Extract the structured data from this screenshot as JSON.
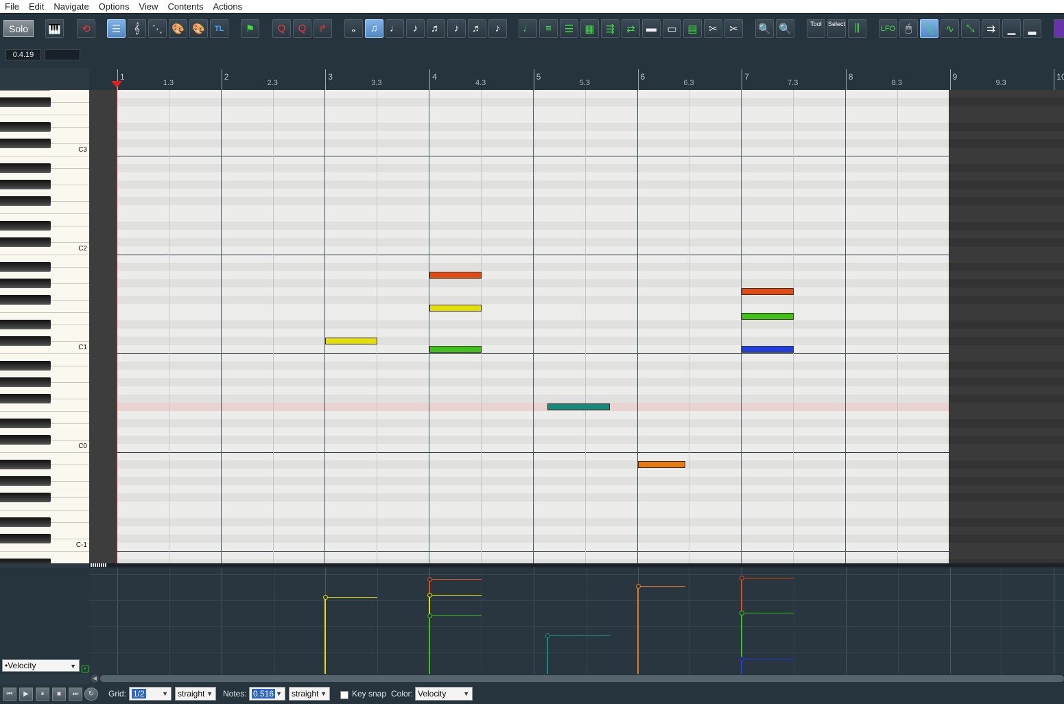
{
  "menu": [
    "File",
    "Edit",
    "Navigate",
    "Options",
    "View",
    "Contents",
    "Actions"
  ],
  "toolbar": {
    "solo_label": "Solo",
    "tl_label": "TL",
    "tool_label": "Tool",
    "select_label": "Select",
    "lfo_label": "LFO"
  },
  "position": {
    "value": "0.4.19",
    "secondary": ""
  },
  "ruler": {
    "bars": [
      "1",
      "2",
      "3",
      "4",
      "5",
      "6",
      "7",
      "8",
      "9",
      "10"
    ],
    "subs": [
      "1.3",
      "2.3",
      "3.3",
      "4.3",
      "5.3",
      "6.3",
      "7.3",
      "8.3",
      "9.3"
    ]
  },
  "keyboard": {
    "labels": [
      "C3",
      "C2",
      "C1",
      "C0",
      "C-1"
    ]
  },
  "notes": [
    {
      "bar": 3,
      "start": 3.0,
      "length": 0.5,
      "pitch": "C1+1",
      "color": "#e5df00",
      "velocity": 0.76
    },
    {
      "bar": 4,
      "start": 4.0,
      "length": 0.5,
      "pitch": "C1+9",
      "color": "#e14a14",
      "velocity": 0.94
    },
    {
      "bar": 4,
      "start": 4.0,
      "length": 0.5,
      "pitch": "C1+5",
      "color": "#e5df00",
      "velocity": 0.78
    },
    {
      "bar": 4,
      "start": 4.0,
      "length": 0.5,
      "pitch": "C1",
      "color": "#3fc11c",
      "velocity": 0.57
    },
    {
      "bar": 5,
      "start": 5.13,
      "length": 0.6,
      "pitch": "C0+5",
      "color": "#138a7c",
      "velocity": 0.37
    },
    {
      "bar": 6,
      "start": 6.0,
      "length": 0.46,
      "pitch": "C0-2",
      "color": "#e67a12",
      "velocity": 0.87
    },
    {
      "bar": 7,
      "start": 7.0,
      "length": 0.5,
      "pitch": "C1+7",
      "color": "#e14a14",
      "velocity": 0.95
    },
    {
      "bar": 7,
      "start": 7.0,
      "length": 0.5,
      "pitch": "C1+4",
      "color": "#3fc11c",
      "velocity": 0.6
    },
    {
      "bar": 7,
      "start": 7.0,
      "length": 0.5,
      "pitch": "C1",
      "color": "#1f3de0",
      "velocity": 0.14
    }
  ],
  "velocity_lane": {
    "label": "•Velocity"
  },
  "bottom": {
    "grid_label": "Grid:",
    "grid_value": "1/2",
    "grid_mode": "straight",
    "notes_label": "Notes:",
    "notes_value": "0.516",
    "notes_mode": "straight",
    "keysnap_label": "Key snap",
    "color_label": "Color:",
    "color_value": "Velocity"
  }
}
